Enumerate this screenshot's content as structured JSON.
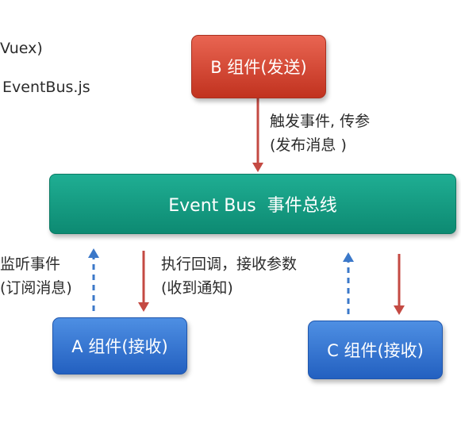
{
  "left_notes": [
    "Vuex)",
    "EventBus.js"
  ],
  "nodes": {
    "sender": "B 组件(发送)",
    "bus": "Event Bus  事件总线",
    "receiver_a": "A 组件(接收)",
    "receiver_c": "C 组件(接收)"
  },
  "labels": {
    "emit_line1": "触发事件, 传参",
    "emit_line2": "(发布消息 )",
    "listen_line1": "监听事件",
    "listen_line2": "(订阅消息)",
    "callback_line1": "执行回调，接收参数",
    "callback_line2": "(收到通知)"
  },
  "colors": {
    "sender_box": "#d9483a",
    "bus_box": "#109b80",
    "receiver_box": "#3273d3",
    "solid_arrow": "#c44a43",
    "dashed_arrow": "#3b78c9"
  }
}
